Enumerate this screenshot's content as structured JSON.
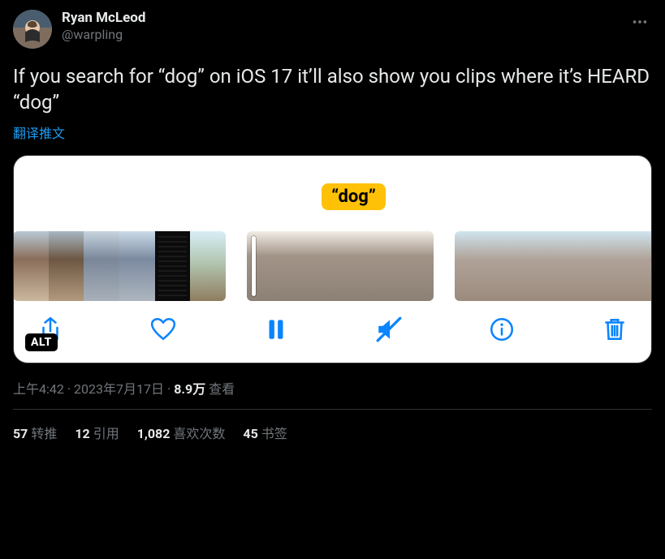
{
  "author": {
    "display_name": "Ryan McLeod",
    "handle": "@warpling"
  },
  "tweet_text": "If you search for “dog” on iOS 17 it’ll also show you clips where it’s HEARD “dog”",
  "translate_label": "翻译推文",
  "media": {
    "caption_text": "“dog”",
    "alt_badge": "ALT",
    "toolbar_icons": [
      "share",
      "heart",
      "pause",
      "mute",
      "info",
      "trash"
    ]
  },
  "meta": {
    "time": "上午4:42",
    "date": "2023年7月17日",
    "views_count": "8.9万",
    "views_label": "查看"
  },
  "stats": {
    "retweets": {
      "count": "57",
      "label": "转推"
    },
    "quotes": {
      "count": "12",
      "label": "引用"
    },
    "likes": {
      "count": "1,082",
      "label": "喜欢次数"
    },
    "bookmarks": {
      "count": "45",
      "label": "书签"
    }
  }
}
